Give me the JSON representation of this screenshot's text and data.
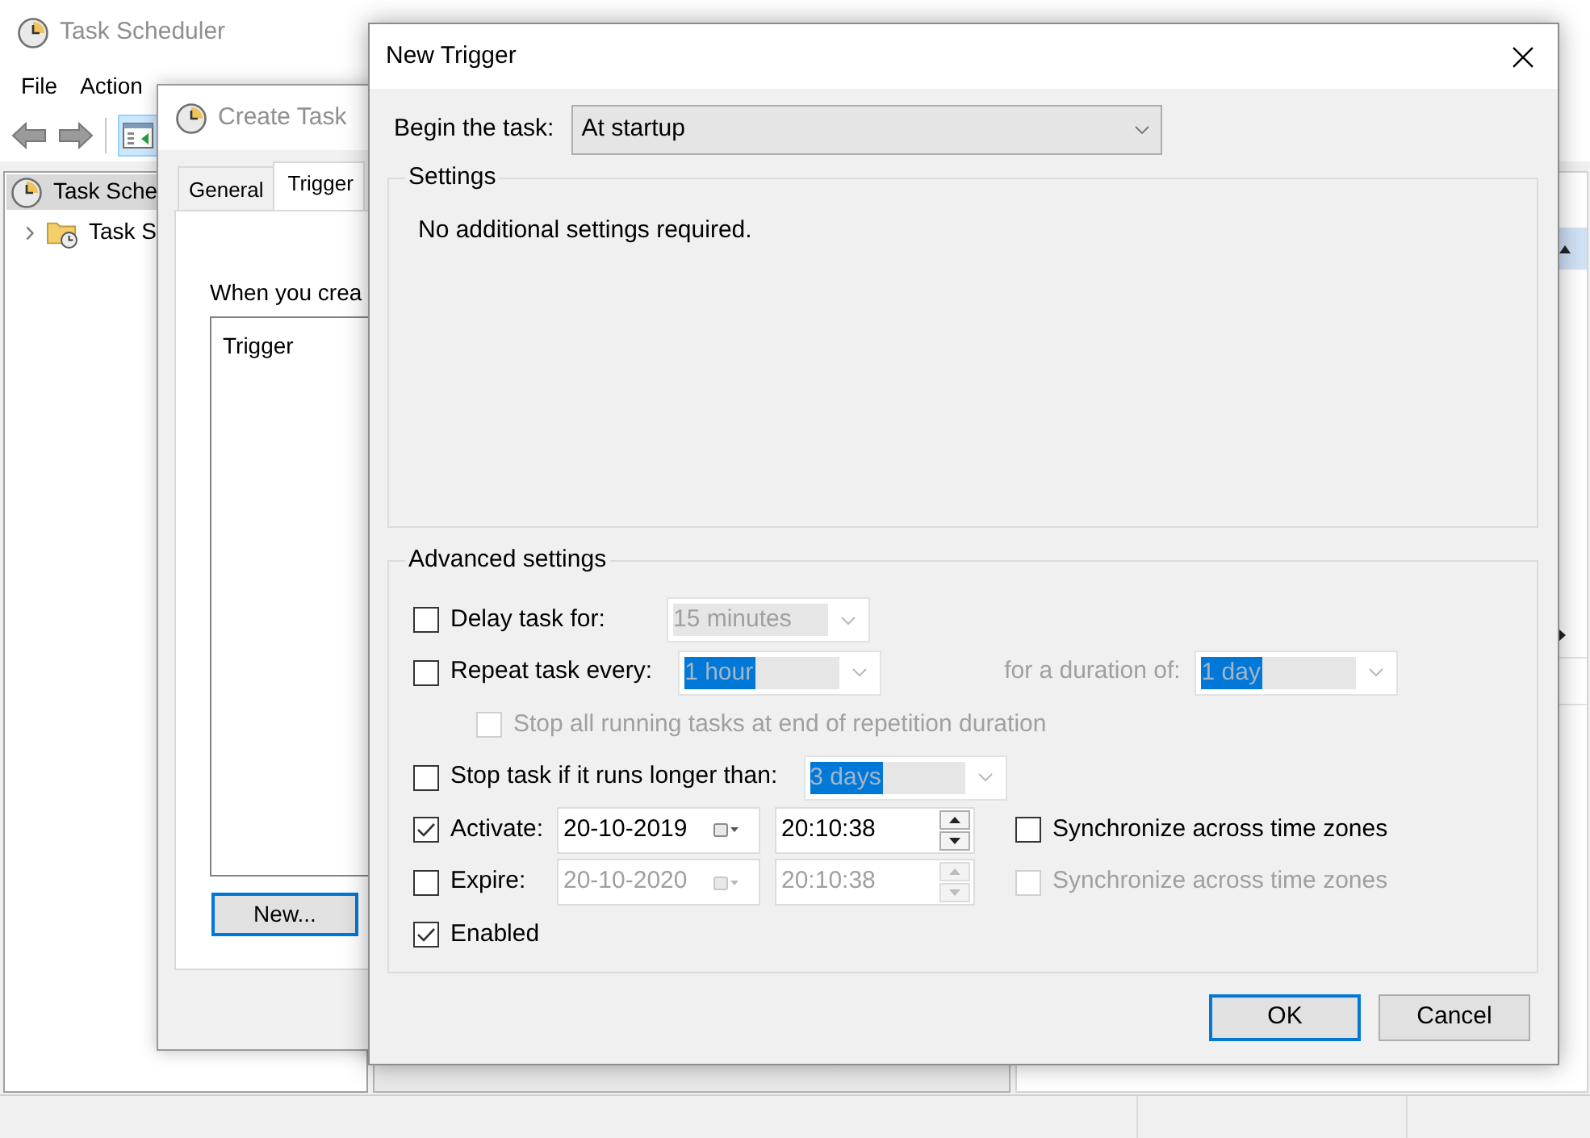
{
  "main_window": {
    "title": {
      "text": "Task Scheduler",
      "active": false
    },
    "menu": [
      "File",
      "Action"
    ],
    "tree": [
      {
        "label": "Task Sche",
        "selected": true,
        "children": [
          {
            "label": "Task S",
            "selected": false,
            "expanded": false
          }
        ]
      }
    ]
  },
  "create_task": {
    "title": {
      "text": "Create Task",
      "active": false
    },
    "tabs": [
      {
        "label": "General",
        "selected": false
      },
      {
        "label": "Trigger",
        "selected": true
      }
    ],
    "intro": "When you crea",
    "list_header": "Trigger",
    "new_button": {
      "label": "New...",
      "default": true
    }
  },
  "new_trigger": {
    "title": {
      "text": "New Trigger",
      "active": true
    },
    "begin": {
      "label": "Begin the task:",
      "value": "At startup"
    },
    "settings": {
      "legend": "Settings",
      "message": "No additional settings required."
    },
    "advanced": {
      "legend": "Advanced settings",
      "rows": [
        {
          "checkbox": {
            "label": "Delay task for:",
            "checked": false,
            "disabled": false
          },
          "fields": [
            {
              "kind": "combo",
              "value": "15 minutes",
              "disabled": true,
              "highlighted": false
            }
          ]
        },
        {
          "checkbox": {
            "label": "Repeat task every:",
            "checked": false,
            "disabled": false
          },
          "fields": [
            {
              "kind": "combo",
              "value": "1 hour",
              "disabled": true,
              "highlighted": true
            },
            {
              "kind": "label",
              "text": "for a duration of:",
              "disabled": true
            },
            {
              "kind": "combo",
              "value": "1 day",
              "disabled": true,
              "highlighted": true
            }
          ],
          "children": [
            {
              "checkbox": {
                "label": "Stop all running tasks at end of repetition duration",
                "checked": false,
                "disabled": true
              }
            }
          ]
        },
        {
          "checkbox": {
            "label": "Stop task if it runs longer than:",
            "checked": false,
            "disabled": false
          },
          "fields": [
            {
              "kind": "combo",
              "value": "3 days",
              "disabled": true,
              "highlighted": true
            }
          ]
        },
        {
          "checkbox": {
            "label": "Activate:",
            "checked": true,
            "disabled": false
          },
          "fields": [
            {
              "kind": "date",
              "value": "20-10-2019",
              "disabled": false
            },
            {
              "kind": "time",
              "value": "20:10:38",
              "disabled": false
            },
            {
              "kind": "checkbox",
              "label": "Synchronize across time zones",
              "checked": false,
              "disabled": false
            }
          ]
        },
        {
          "checkbox": {
            "label": "Expire:",
            "checked": false,
            "disabled": false
          },
          "fields": [
            {
              "kind": "date",
              "value": "20-10-2020",
              "disabled": true
            },
            {
              "kind": "time",
              "value": "20:10:38",
              "disabled": true
            },
            {
              "kind": "checkbox",
              "label": "Synchronize across time zones",
              "checked": false,
              "disabled": true
            }
          ]
        },
        {
          "checkbox": {
            "label": "Enabled",
            "checked": true,
            "disabled": false
          }
        }
      ]
    },
    "buttons": [
      {
        "label": "OK",
        "default": true
      },
      {
        "label": "Cancel",
        "default": false
      }
    ]
  }
}
